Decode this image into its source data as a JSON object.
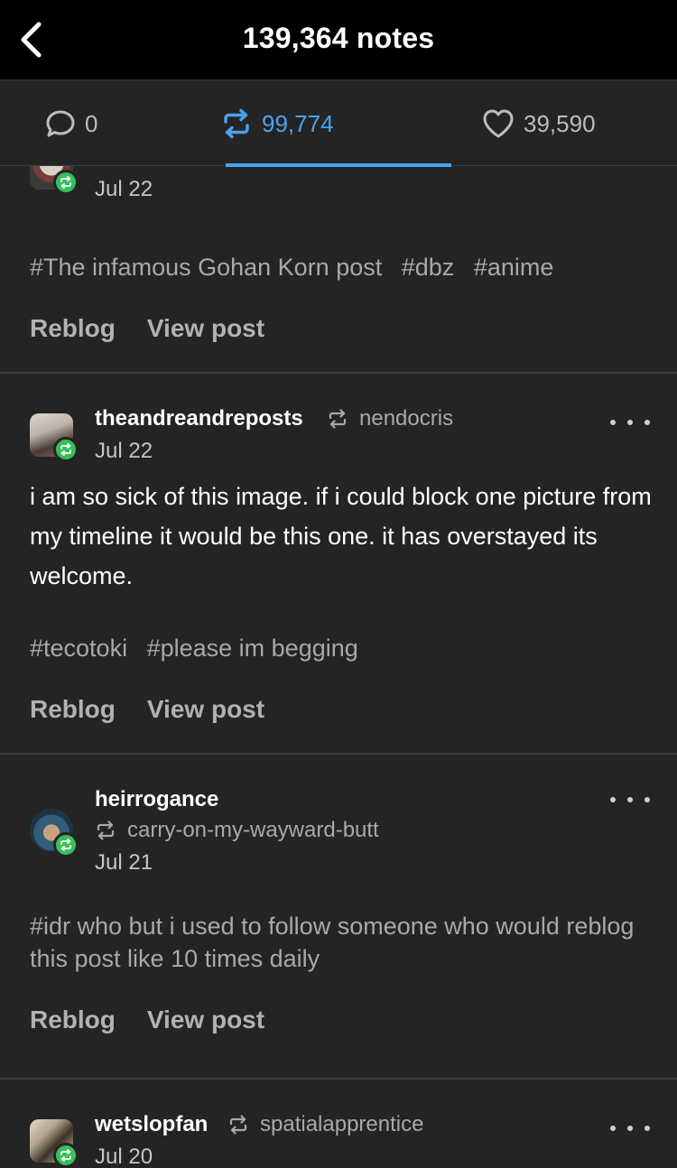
{
  "header": {
    "title": "139,364 notes"
  },
  "tabs": {
    "replies": "0",
    "reblogs": "99,774",
    "likes": "39,590",
    "active_color": "#4aa3ec"
  },
  "posts": [
    {
      "date": "Jul 22",
      "tags": [
        "#The infamous Gohan Korn post",
        "#dbz",
        "#anime"
      ],
      "actions": {
        "reblog": "Reblog",
        "view": "View post"
      }
    },
    {
      "username": "theandreandreposts",
      "via": "nendocris",
      "date": "Jul 22",
      "body": "i am so sick of this image. if i could block one picture from my timeline it would be this one. it has overstayed its welcome.",
      "tags": [
        "#tecotoki",
        "#please im begging"
      ],
      "actions": {
        "reblog": "Reblog",
        "view": "View post"
      }
    },
    {
      "username": "heirrogance",
      "via": "carry-on-my-wayward-butt",
      "date": "Jul 21",
      "tags": [
        "#idr who but i used to follow someone who would reblog this post like 10 times daily"
      ],
      "actions": {
        "reblog": "Reblog",
        "view": "View post"
      }
    },
    {
      "username": "wetslopfan",
      "via": "spatialapprentice",
      "date": "Jul 20"
    }
  ],
  "colors": {
    "background": "#242424",
    "header": "#000000",
    "badge": "#37c05a"
  }
}
